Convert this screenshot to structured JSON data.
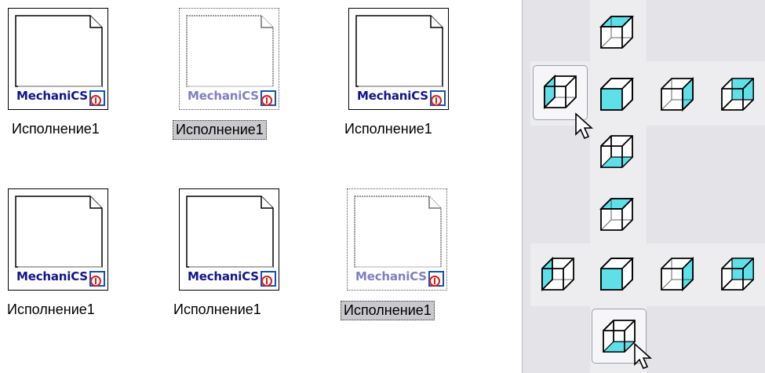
{
  "app": {
    "brand_text": "MechaniCS"
  },
  "tiles": [
    {
      "caption": "Исполнение1"
    },
    {
      "caption": "Исполнение1"
    },
    {
      "caption": "Исполнение1"
    },
    {
      "caption": "Исполнение1"
    },
    {
      "caption": "Исполнение1"
    },
    {
      "caption": "Исполнение1"
    }
  ],
  "colors": {
    "brand": "#14148c",
    "face_cyan": "#5fe0e8",
    "selected_caption_bg": "#c9c9cd",
    "panel_bg": "#e3e3e8"
  },
  "icons": {
    "document": "document-icon",
    "cube": "view-cube-icon",
    "cursor": "mouse-cursor-icon"
  }
}
